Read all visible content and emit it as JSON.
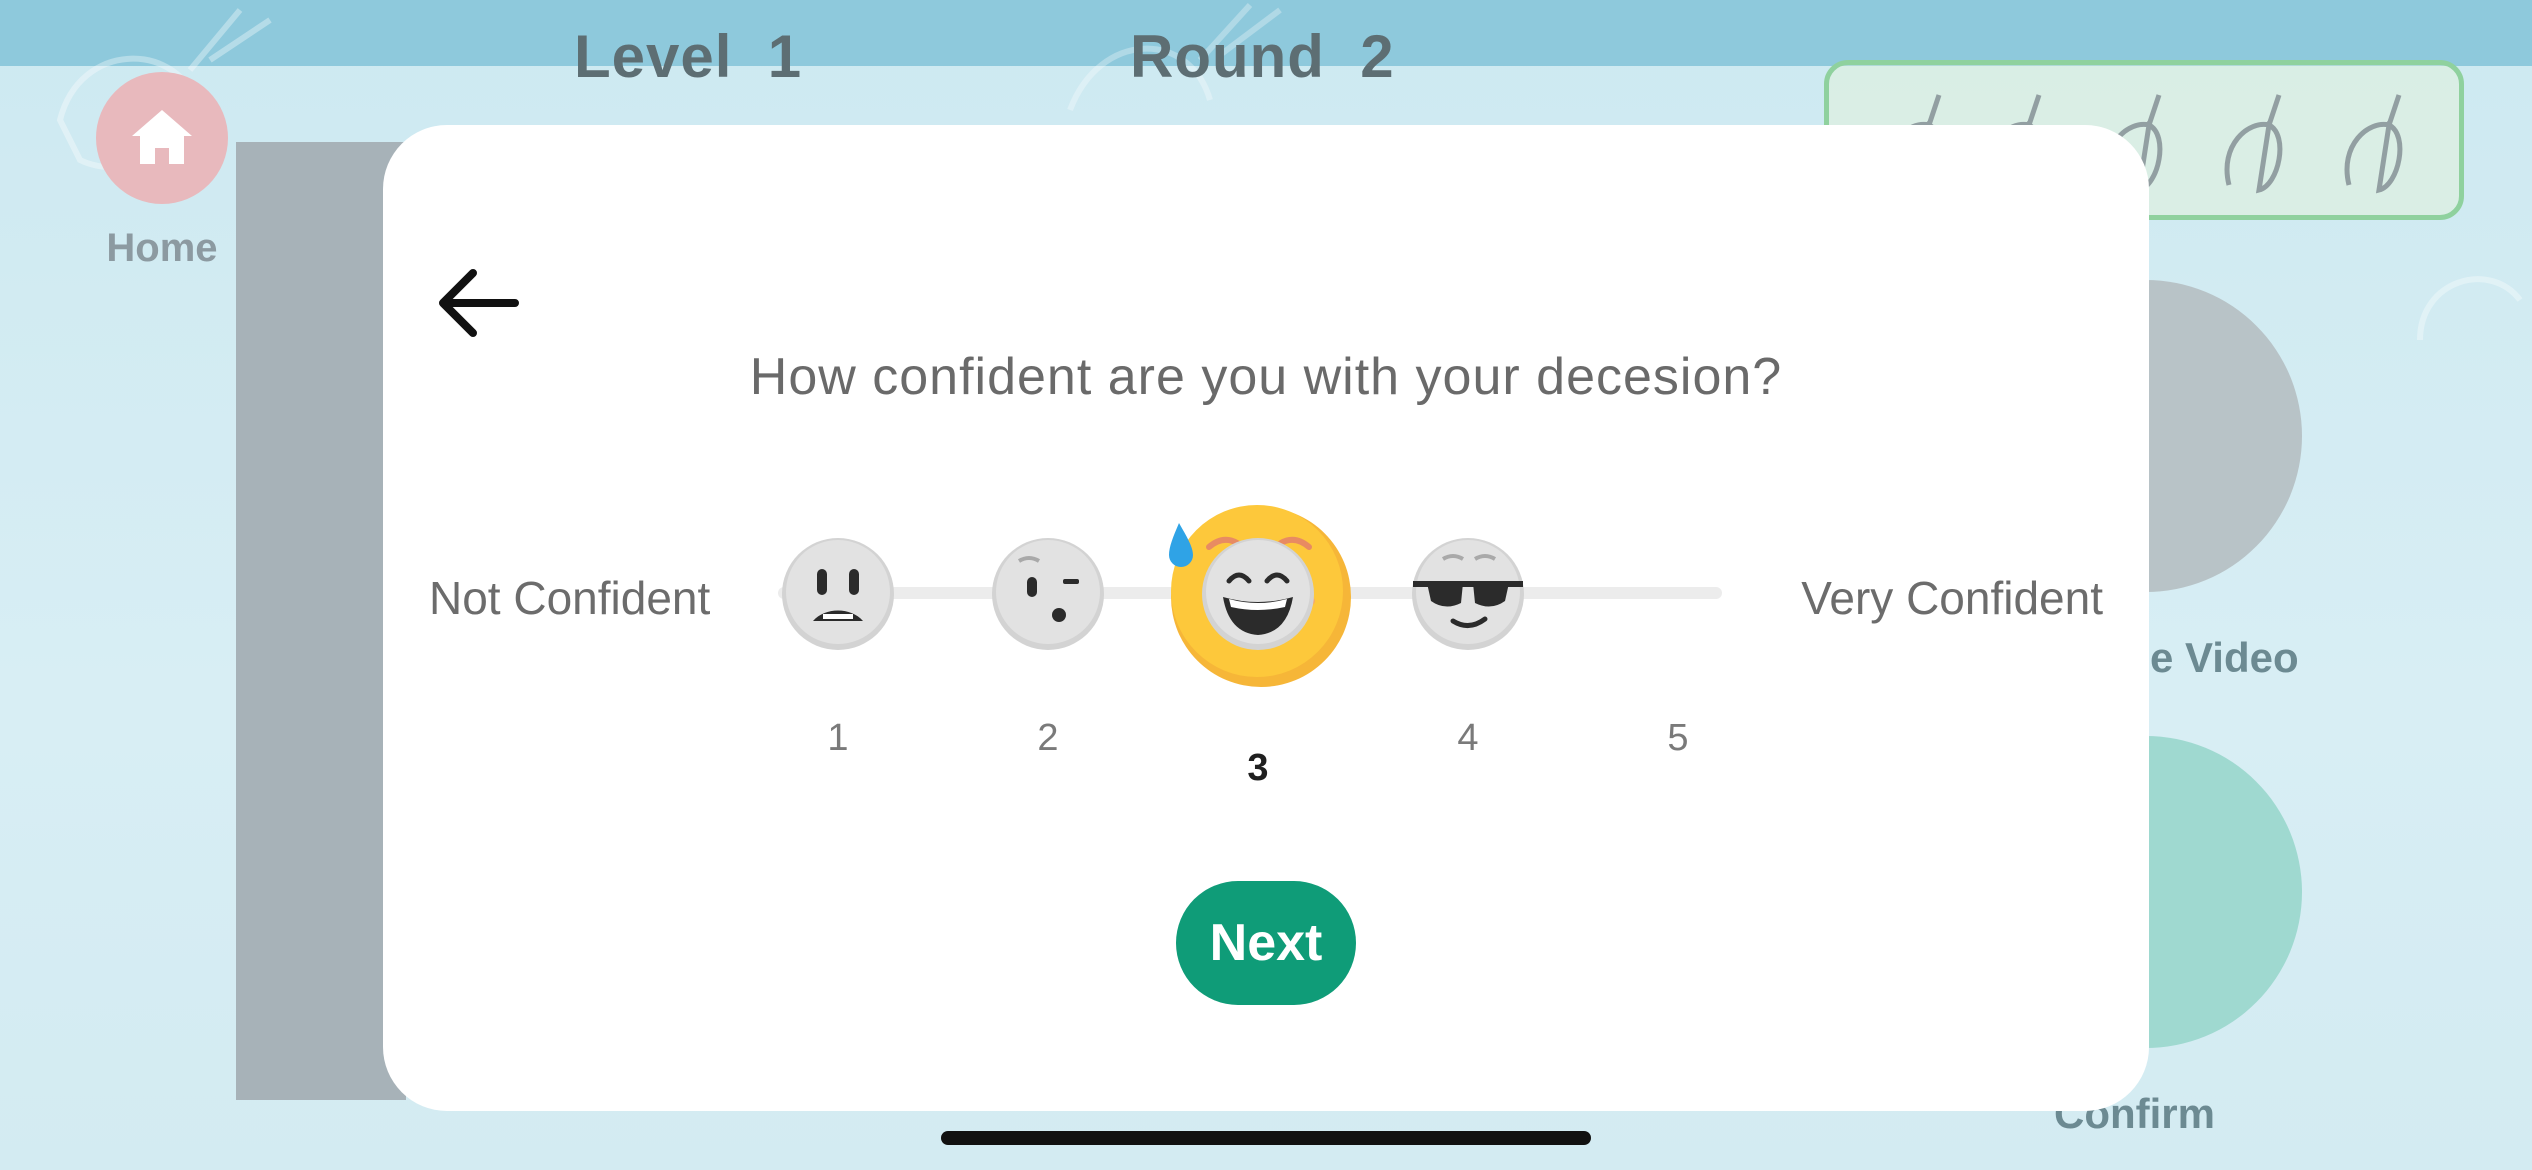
{
  "hud": {
    "level_label": "Level",
    "level_value": "1",
    "round_label": "Round",
    "round_value": "2"
  },
  "home": {
    "label": "Home",
    "icon": "home-icon"
  },
  "side_buttons": {
    "video_label": "e Video",
    "confirm_label": "Confirm"
  },
  "modal": {
    "question": "How confident are you with your decesion?",
    "left_label": "Not Confident",
    "right_label": "Very Confident",
    "options": [
      {
        "number": "1",
        "icon": "fearful-face-icon"
      },
      {
        "number": "2",
        "icon": "skeptical-face-icon"
      },
      {
        "number": "3",
        "icon": "sweat-smile-face-icon"
      },
      {
        "number": "4",
        "icon": "grinning-face-icon"
      },
      {
        "number": "5",
        "icon": "sunglasses-face-icon"
      }
    ],
    "selected_value": 3,
    "next_label": "Next"
  },
  "colors": {
    "accent": "#0f9c78",
    "selected_emoji": "#fdc83b",
    "unselected_emoji": "#d6d6d6"
  }
}
